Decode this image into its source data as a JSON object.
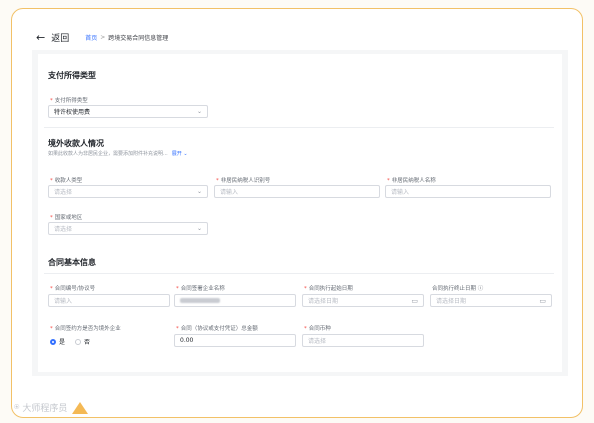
{
  "topbar": {
    "back_icon": "←",
    "back_label": "返回"
  },
  "breadcrumb": {
    "home": "首页",
    "sep": ">",
    "current": "跨境交易合同信息管理"
  },
  "section_payment": {
    "title": "支付所得类型",
    "field": {
      "label": "支付所得类型",
      "value": "特许权使用费"
    }
  },
  "section_payee": {
    "title": "境外收款人情况",
    "hint": "如果此收款人为非居民企业，需要添加附件补充说明...",
    "hint_more": "展开",
    "fields": [
      {
        "label": "收款人类型",
        "value": "请选择"
      },
      {
        "label": "非居民纳税人识别号",
        "value": "请输入"
      },
      {
        "label": "非居民纳税人名称",
        "value": "请输入"
      },
      {
        "label": "国家或地区",
        "value": "请选择"
      }
    ]
  },
  "section_contract": {
    "title": "合同基本信息",
    "fields": [
      {
        "label": "合同编号/协议号",
        "value": "请输入"
      },
      {
        "label": "合同签署企业名称",
        "value": ""
      },
      {
        "label": "合同执行起始日期",
        "value": "请选择日期"
      },
      {
        "label": "合同执行终止日期",
        "value": "请选择日期"
      },
      {
        "label": "合同签约方是否为境外企业",
        "value": ""
      },
      {
        "label": "合同（协议或支付凭证）总金额",
        "value": "0.00"
      },
      {
        "label": "合同币种",
        "value": "请选择"
      }
    ],
    "radio_yes": "是",
    "radio_no": "否"
  },
  "watermark": {
    "text": "大师程序员"
  }
}
